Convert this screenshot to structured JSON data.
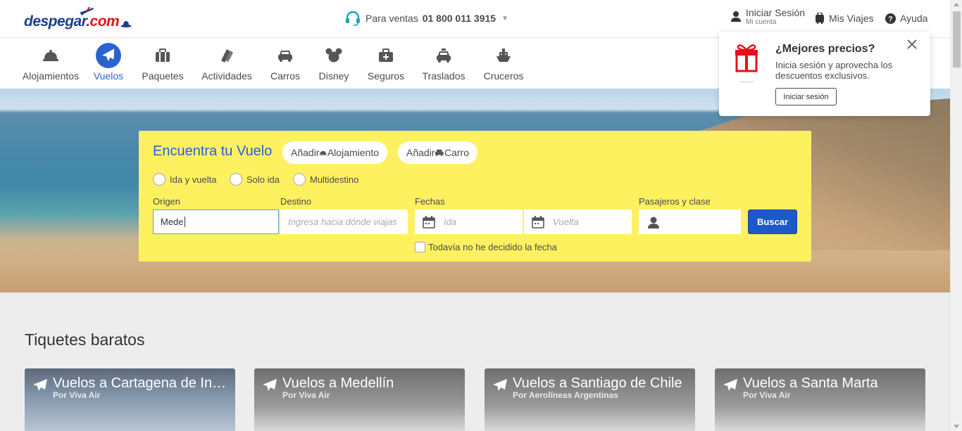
{
  "header": {
    "logo_text": "despegar",
    "logo_dot": ".com",
    "sales_label": "Para ventas",
    "sales_number": "01 800 011 3915",
    "signin_label": "Iniciar Sesión",
    "signin_sub": "Mi cuenta",
    "trips_label": "Mis Viajes",
    "help_label": "Ayuda"
  },
  "products": [
    {
      "label": "Alojamientos",
      "icon": "hotel-bell-icon"
    },
    {
      "label": "Vuelos",
      "icon": "plane-icon",
      "active": true
    },
    {
      "label": "Paquetes",
      "icon": "suitcase-icon"
    },
    {
      "label": "Actividades",
      "icon": "tickets-icon"
    },
    {
      "label": "Carros",
      "icon": "car-icon"
    },
    {
      "label": "Disney",
      "icon": "mickey-icon"
    },
    {
      "label": "Seguros",
      "icon": "medical-case-icon"
    },
    {
      "label": "Traslados",
      "icon": "taxi-icon"
    },
    {
      "label": "Cruceros",
      "icon": "ship-icon"
    }
  ],
  "promo": {
    "title": "¿Mejores precios?",
    "text": "Inicia sesión y aprovecha los descuentos exclusivos.",
    "button": "Iniciar sesión"
  },
  "search": {
    "heading": "Encuentra tu Vuelo",
    "add_hotel": "Añadir",
    "add_hotel_suffix": "Alojamiento",
    "add_car": "Añadir",
    "add_car_suffix": "Carro",
    "trip_types": [
      "Ida y vuelta",
      "Solo ida",
      "Multidestino"
    ],
    "origin_label": "Origen",
    "origin_value": "Mede",
    "destination_label": "Destino",
    "destination_placeholder": "Ingresa hacia dónde viajas",
    "dates_label": "Fechas",
    "departure_placeholder": "Ida",
    "return_placeholder": "Vuelta",
    "passengers_label": "Pasajeros y clase",
    "search_button": "Buscar",
    "undecided_label": "Todavía no he decidido la fecha"
  },
  "deals": {
    "title": "Tiquetes baratos",
    "cards": [
      {
        "title": "Vuelos a Cartagena de Indias",
        "airline": "Por Viva Air"
      },
      {
        "title": "Vuelos a Medellín",
        "airline": "Por Viva Air"
      },
      {
        "title": "Vuelos a Santiago de Chile",
        "airline": "Por Aerolíneas Argentinas"
      },
      {
        "title": "Vuelos a Santa Marta",
        "airline": "Por Viva Air"
      }
    ]
  },
  "colors": {
    "brand_blue": "#2a62d0",
    "search_yellow": "#fdf160",
    "button_blue": "#1e58c9",
    "logo_red": "#e4111b"
  }
}
